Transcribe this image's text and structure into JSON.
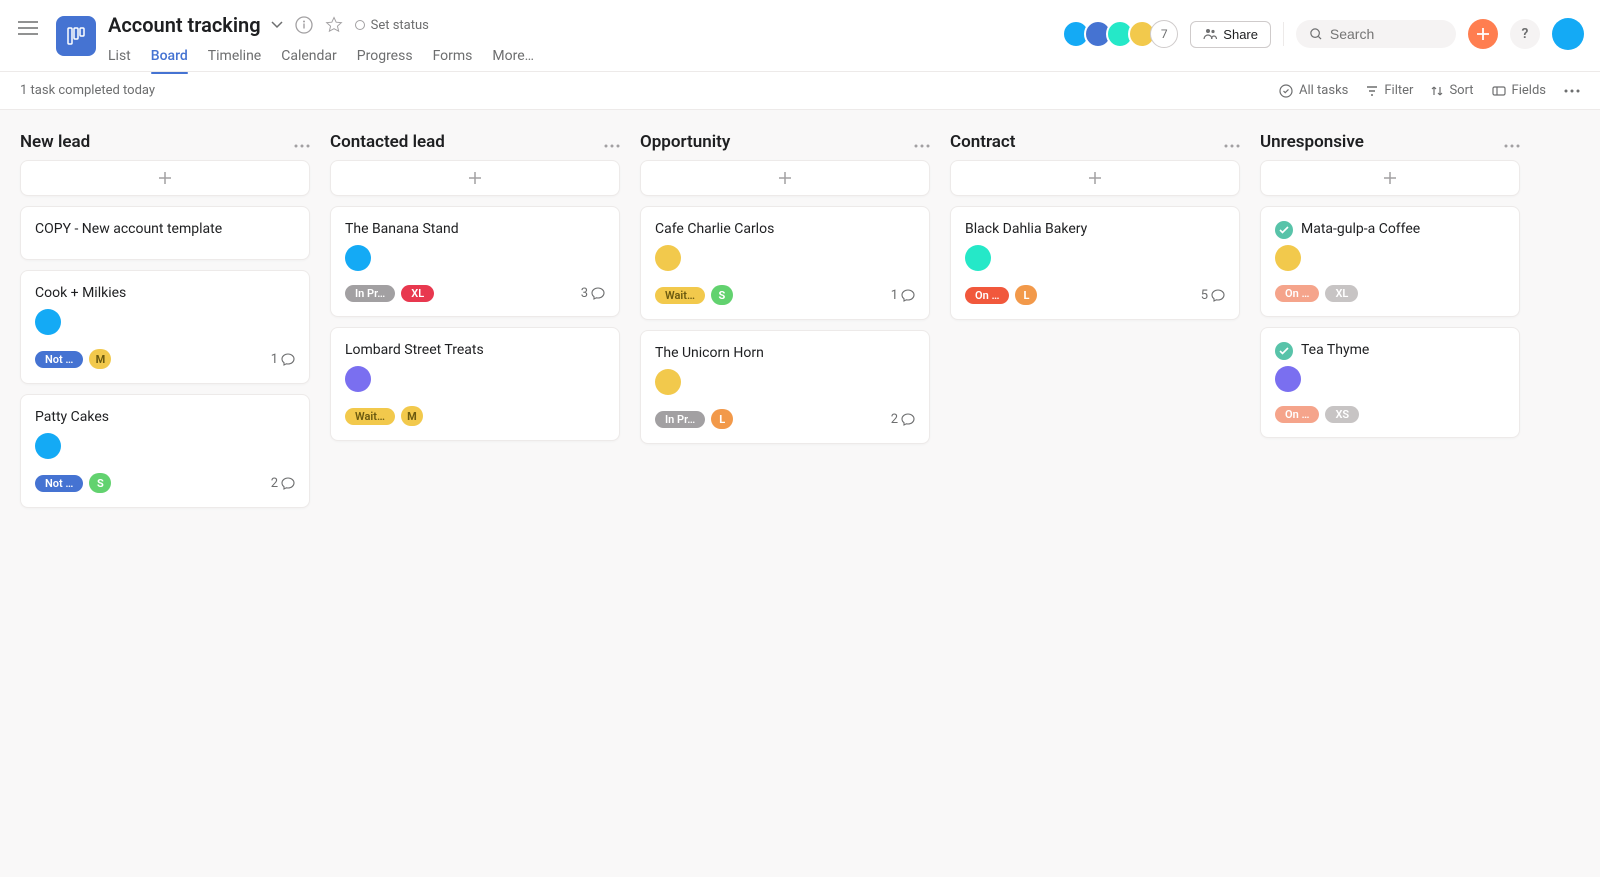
{
  "header": {
    "title": "Account tracking",
    "set_status": "Set status",
    "tabs": [
      "List",
      "Board",
      "Timeline",
      "Calendar",
      "Progress",
      "Forms",
      "More…"
    ],
    "active_tab_index": 1,
    "share": "Share",
    "search_placeholder": "Search",
    "member_overflow": "7"
  },
  "toolbar": {
    "status": "1 task completed today",
    "all_tasks": "All tasks",
    "filter": "Filter",
    "sort": "Sort",
    "fields": "Fields"
  },
  "columns": [
    {
      "title": "New lead",
      "cards": [
        {
          "title": "COPY - New account template"
        },
        {
          "title": "Cook + Milkies",
          "avatar": "bg-teal",
          "tags": [
            {
              "label": "Not …",
              "style": "blue"
            },
            {
              "label": "M",
              "style": "yellow sz"
            }
          ],
          "comments": 1
        },
        {
          "title": "Patty Cakes",
          "avatar": "bg-teal",
          "tags": [
            {
              "label": "Not …",
              "style": "blue"
            },
            {
              "label": "S",
              "style": "green sz"
            }
          ],
          "comments": 2
        }
      ]
    },
    {
      "title": "Contacted lead",
      "cards": [
        {
          "title": "The Banana Stand",
          "avatar": "bg-teal",
          "tags": [
            {
              "label": "In Pr…",
              "style": "gray"
            },
            {
              "label": "XL",
              "style": "red"
            }
          ],
          "comments": 3
        },
        {
          "title": "Lombard Street Treats",
          "avatar": "bg-purple",
          "tags": [
            {
              "label": "Wait…",
              "style": "yellow-pill"
            },
            {
              "label": "M",
              "style": "yellow sz"
            }
          ]
        }
      ]
    },
    {
      "title": "Opportunity",
      "cards": [
        {
          "title": "Cafe Charlie Carlos",
          "avatar": "bg-yellow",
          "tags": [
            {
              "label": "Wait…",
              "style": "yellow-pill"
            },
            {
              "label": "S",
              "style": "green sz"
            }
          ],
          "comments": 1
        },
        {
          "title": "The Unicorn Horn",
          "avatar": "bg-yellow",
          "tags": [
            {
              "label": "In Pr…",
              "style": "gray"
            },
            {
              "label": "L",
              "style": "orange sz"
            }
          ],
          "comments": 2
        }
      ]
    },
    {
      "title": "Contract",
      "cards": [
        {
          "title": "Black Dahlia Bakery",
          "avatar": "bg-green",
          "tags": [
            {
              "label": "On …",
              "style": "red-orange"
            },
            {
              "label": "L",
              "style": "orange sz"
            }
          ],
          "comments": 5
        }
      ]
    },
    {
      "title": "Unresponsive",
      "cards": [
        {
          "title": "Mata-gulp-a Coffee",
          "done": true,
          "avatar": "bg-yellow",
          "tags": [
            {
              "label": "On …",
              "style": "peach"
            },
            {
              "label": "XL",
              "style": "gray-light"
            }
          ]
        },
        {
          "title": "Tea Thyme",
          "done": true,
          "avatar": "bg-purple",
          "tags": [
            {
              "label": "On …",
              "style": "peach"
            },
            {
              "label": "XS",
              "style": "gray-light"
            }
          ]
        }
      ]
    }
  ]
}
